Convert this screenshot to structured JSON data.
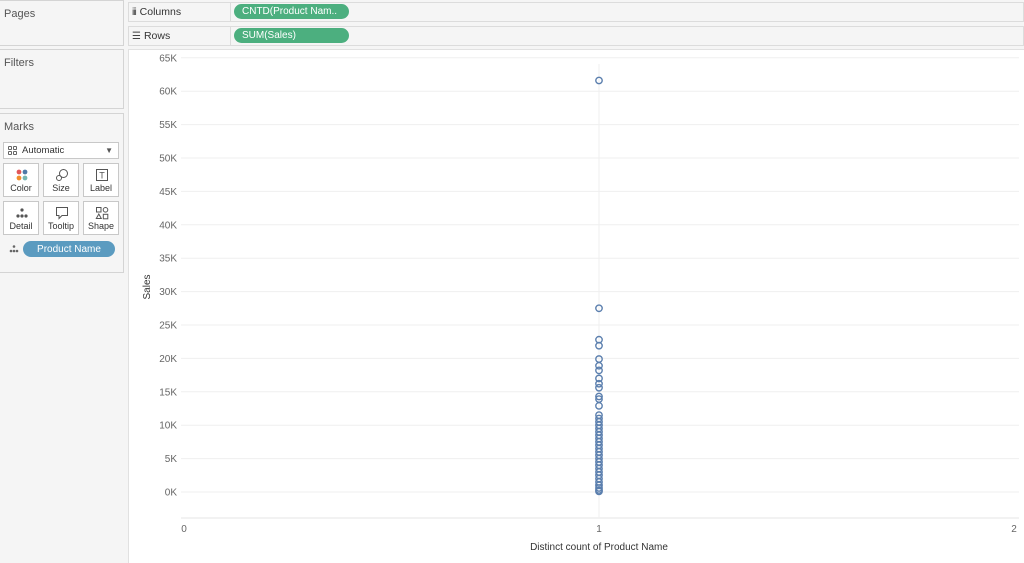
{
  "left_panel": {
    "pages_title": "Pages",
    "filters_title": "Filters",
    "marks_title": "Marks",
    "mark_type": "Automatic",
    "mark_buttons": [
      {
        "label": "Color",
        "icon": "color-icon"
      },
      {
        "label": "Size",
        "icon": "size-icon"
      },
      {
        "label": "Label",
        "icon": "label-icon"
      },
      {
        "label": "Detail",
        "icon": "detail-icon"
      },
      {
        "label": "Tooltip",
        "icon": "tooltip-icon"
      },
      {
        "label": "Shape",
        "icon": "shape-icon"
      }
    ],
    "detail_field": "Product Name"
  },
  "shelves": {
    "columns_label": "Columns",
    "columns_pill": "CNTD(Product Nam..",
    "rows_label": "Rows",
    "rows_pill": "SUM(Sales)"
  },
  "colors": {
    "green_pill": "#4caf7f",
    "blue_pill": "#5b9bc0",
    "mark": "#5b7fae"
  },
  "chart_data": {
    "type": "scatter",
    "xlabel": "Distinct count of Product Name",
    "ylabel": "Sales",
    "xlim": [
      0,
      2
    ],
    "ylim": [
      -5000,
      65000
    ],
    "x_ticks": [
      0,
      1,
      2
    ],
    "y_ticks": [
      0,
      5000,
      10000,
      15000,
      20000,
      25000,
      30000,
      35000,
      40000,
      45000,
      50000,
      55000,
      60000,
      65000
    ],
    "y_tick_labels": [
      "0K",
      "5K",
      "10K",
      "15K",
      "20K",
      "25K",
      "30K",
      "35K",
      "40K",
      "45K",
      "50K",
      "55K",
      "60K",
      "65K"
    ],
    "grid": true,
    "marker": "open-circle",
    "points": [
      {
        "x": 1,
        "y": 61600
      },
      {
        "x": 1,
        "y": 27500
      },
      {
        "x": 1,
        "y": 22800
      },
      {
        "x": 1,
        "y": 21900
      },
      {
        "x": 1,
        "y": 19900
      },
      {
        "x": 1,
        "y": 18900
      },
      {
        "x": 1,
        "y": 18200
      },
      {
        "x": 1,
        "y": 17000
      },
      {
        "x": 1,
        "y": 16200
      },
      {
        "x": 1,
        "y": 15600
      },
      {
        "x": 1,
        "y": 14300
      },
      {
        "x": 1,
        "y": 13900
      },
      {
        "x": 1,
        "y": 12900
      },
      {
        "x": 1,
        "y": 11500
      },
      {
        "x": 1,
        "y": 11000
      },
      {
        "x": 1,
        "y": 10500
      },
      {
        "x": 1,
        "y": 10000
      },
      {
        "x": 1,
        "y": 9500
      },
      {
        "x": 1,
        "y": 9000
      },
      {
        "x": 1,
        "y": 8500
      },
      {
        "x": 1,
        "y": 8000
      },
      {
        "x": 1,
        "y": 7500
      },
      {
        "x": 1,
        "y": 7000
      },
      {
        "x": 1,
        "y": 6500
      },
      {
        "x": 1,
        "y": 6000
      },
      {
        "x": 1,
        "y": 5500
      },
      {
        "x": 1,
        "y": 5000
      },
      {
        "x": 1,
        "y": 4500
      },
      {
        "x": 1,
        "y": 4000
      },
      {
        "x": 1,
        "y": 3500
      },
      {
        "x": 1,
        "y": 3000
      },
      {
        "x": 1,
        "y": 2500
      },
      {
        "x": 1,
        "y": 2000
      },
      {
        "x": 1,
        "y": 1500
      },
      {
        "x": 1,
        "y": 1000
      },
      {
        "x": 1,
        "y": 600
      },
      {
        "x": 1,
        "y": 300
      },
      {
        "x": 1,
        "y": 100
      }
    ]
  }
}
